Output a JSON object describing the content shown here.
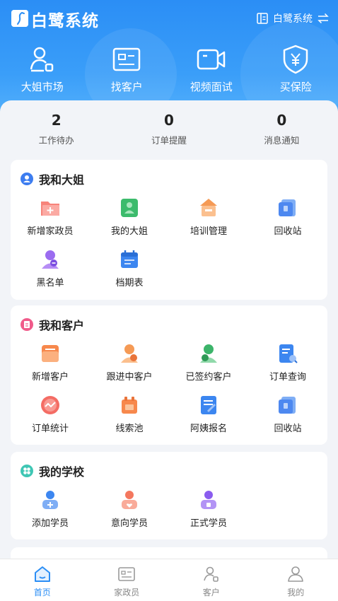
{
  "app": {
    "title": "白鹭系统",
    "switch_label": "白鹭系统"
  },
  "quick_nav": [
    {
      "label": "大姐市场",
      "icon": "person-market-icon"
    },
    {
      "label": "找客户",
      "icon": "id-card-icon"
    },
    {
      "label": "视频面试",
      "icon": "video-camera-icon"
    },
    {
      "label": "买保险",
      "icon": "shield-yen-icon"
    }
  ],
  "stats": [
    {
      "value": "2",
      "label": "工作待办"
    },
    {
      "value": "0",
      "label": "订单提醒"
    },
    {
      "value": "0",
      "label": "消息通知"
    }
  ],
  "sections": [
    {
      "title": "我和大姐",
      "items": [
        {
          "label": "新增家政员",
          "icon": "add-housekeeper-icon"
        },
        {
          "label": "我的大姐",
          "icon": "my-helper-icon"
        },
        {
          "label": "培训管理",
          "icon": "training-icon"
        },
        {
          "label": "回收站",
          "icon": "recycle-bin-icon"
        },
        {
          "label": "黑名单",
          "icon": "blacklist-icon"
        },
        {
          "label": "档期表",
          "icon": "schedule-icon"
        }
      ]
    },
    {
      "title": "我和客户",
      "items": [
        {
          "label": "新增客户",
          "icon": "add-customer-icon"
        },
        {
          "label": "跟进中客户",
          "icon": "following-customer-icon"
        },
        {
          "label": "已签约客户",
          "icon": "signed-customer-icon"
        },
        {
          "label": "订单查询",
          "icon": "order-search-icon"
        },
        {
          "label": "订单统计",
          "icon": "order-stats-icon"
        },
        {
          "label": "线索池",
          "icon": "lead-pool-icon"
        },
        {
          "label": "阿姨报名",
          "icon": "registration-icon"
        },
        {
          "label": "回收站",
          "icon": "recycle-bin-icon"
        }
      ]
    },
    {
      "title": "我的学校",
      "items": [
        {
          "label": "添加学员",
          "icon": "add-student-icon"
        },
        {
          "label": "意向学员",
          "icon": "prospective-student-icon"
        },
        {
          "label": "正式学员",
          "icon": "enrolled-student-icon"
        }
      ]
    }
  ],
  "tabbar": [
    {
      "label": "首页",
      "icon": "home-icon",
      "active": true
    },
    {
      "label": "家政员",
      "icon": "id-card-icon"
    },
    {
      "label": "客户",
      "icon": "customer-icon"
    },
    {
      "label": "我的",
      "icon": "profile-icon"
    }
  ],
  "colors": {
    "primary": "#2b8ef5",
    "background": "#f2f4f8"
  }
}
